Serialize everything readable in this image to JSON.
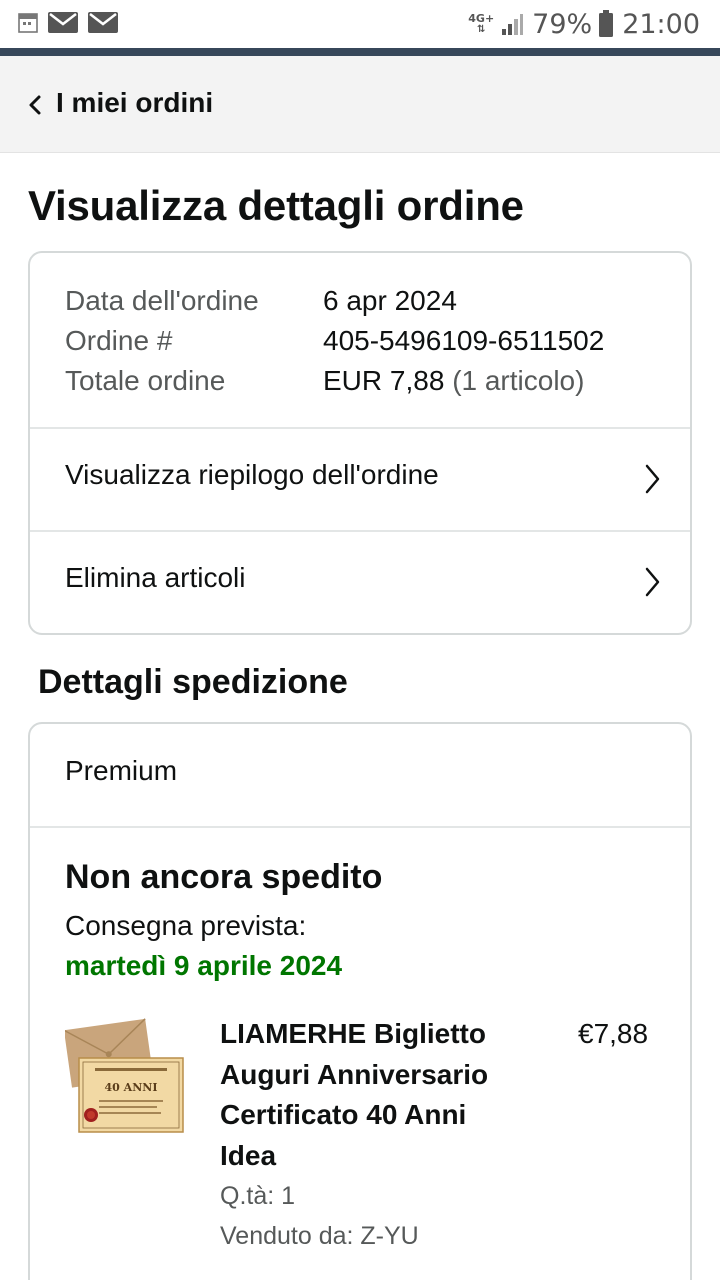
{
  "status_bar": {
    "network": "4G+",
    "battery": "79%",
    "time": "21:00",
    "icons": [
      "calendar-icon",
      "mail-icon",
      "mail-icon",
      "signal-icon",
      "battery-icon"
    ]
  },
  "header": {
    "back_label": "I miei ordini"
  },
  "page_title": "Visualizza dettagli ordine",
  "order_info": {
    "date_label": "Data dell'ordine",
    "date_value": "6 apr 2024",
    "number_label": "Ordine #",
    "number_value": "405-5496109-6511502",
    "total_label": "Totale ordine",
    "total_value": "EUR 7,88",
    "total_items": "(1 articolo)"
  },
  "links": {
    "summary": "Visualizza riepilogo dell'ordine",
    "delete_items": "Elimina articoli"
  },
  "shipping": {
    "section_title": "Dettagli spedizione",
    "type": "Premium",
    "status": "Non ancora spedito",
    "delivery_label": "Consegna prevista:",
    "delivery_date": "martedì 9 aprile 2024"
  },
  "product": {
    "title": "LIAMERHE Biglietto Auguri Anniversario Certificato 40 Anni Idea",
    "price": "€7,88",
    "quantity": "Q.tà: 1",
    "seller": "Venduto da: Z-YU",
    "image_text": "40 ANNI"
  },
  "colors": {
    "accent_bar": "#37475a",
    "delivery_green": "#007600",
    "header_bg": "#f3f3f3"
  }
}
